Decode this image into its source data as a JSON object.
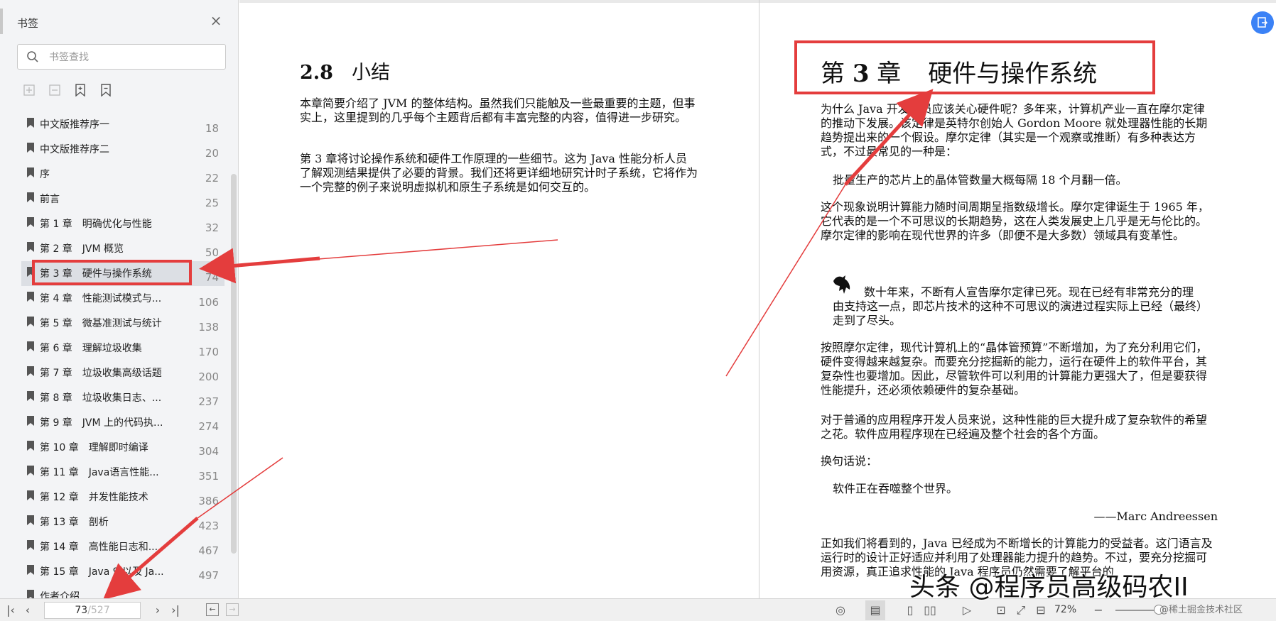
{
  "sidebar": {
    "title": "书签",
    "search_placeholder": "书签查找",
    "items": [
      {
        "label": "中文版推荐序一",
        "page": "18"
      },
      {
        "label": "中文版推荐序二",
        "page": "20"
      },
      {
        "label": "序",
        "page": "22"
      },
      {
        "label": "前言",
        "page": "25"
      },
      {
        "label": "第 1 章　明确优化与性能",
        "page": "32"
      },
      {
        "label": "第 2 章　JVM 概览",
        "page": "50"
      },
      {
        "label": "第 3 章　硬件与操作系统",
        "page": "74"
      },
      {
        "label": "第 4 章　性能测试模式与...",
        "page": "106"
      },
      {
        "label": "第 5 章　微基准测试与统计",
        "page": "138"
      },
      {
        "label": "第 6 章　理解垃圾收集",
        "page": "170"
      },
      {
        "label": "第 7 章　垃圾收集高级话题",
        "page": "200"
      },
      {
        "label": "第 8 章　垃圾收集日志、...",
        "page": "237"
      },
      {
        "label": "第 9 章　JVM 上的代码执...",
        "page": "274"
      },
      {
        "label": "第 10 章　理解即时编译",
        "page": "304"
      },
      {
        "label": "第 11 章　Java语言性能...",
        "page": "351"
      },
      {
        "label": "第 12 章　并发性能技术",
        "page": "386"
      },
      {
        "label": "第 13 章　剖析",
        "page": "423"
      },
      {
        "label": "第 14 章　高性能日志和...",
        "page": "467"
      },
      {
        "label": "第 15 章　Java 9 以及 Ja...",
        "page": "497"
      },
      {
        "label": "作者介绍",
        "page": ""
      }
    ]
  },
  "left_page": {
    "section_num": "2.8",
    "section_title": "小结",
    "p1": "本章简要介绍了 JVM 的整体结构。虽然我们只能触及一些最重要的主题，但事实上，这里提到的几乎每个主题背后都有丰富完整的内容，值得进一步研究。",
    "p2": "第 3 章将讨论操作系统和硬件工作原理的一些细节。这为 Java 性能分析人员了解观测结果提供了必要的背景。我们还将更详细地研究计时子系统，它将作为一个完整的例子来说明虚拟机和原生子系统是如何交互的。"
  },
  "right_page": {
    "chapter_pre": "第",
    "chapter_num": "3",
    "chapter_post": "章",
    "chapter_title": "硬件与操作系统",
    "p1": "为什么 Java 开发人员应该关心硬件呢？多年来，计算机产业一直在摩尔定律的推动下发展。该定律是英特尔创始人 Gordon Moore 就处理器性能的长期趋势提出来的一个假设。摩尔定律（其实是一个观察或推断）有多种表达方式，不过最常见的一种是：",
    "quote1": "批量生产的芯片上的晶体管数量大概每隔 18 个月翻一倍。",
    "p2": "这个现象说明计算能力随时间周期呈指数级增长。摩尔定律诞生于 1965 年，它代表的是一个不可思议的长期趋势，这在人类发展史上几乎是无与伦比的。摩尔定律的影响在现代世界的许多（即便不是大多数）领域具有变革性。",
    "note": "数十年来，不断有人宣告摩尔定律已死。现在已经有非常充分的理由支持这一点，即芯片技术的这种不可思议的演进过程实际上已经（最终）走到了尽头。",
    "p3": "按照摩尔定律，现代计算机上的“晶体管预算”不断增加，为了充分利用它们，硬件变得越来越复杂。而要充分挖掘新的能力，运行在硬件上的软件平台，其复杂性也要增加。因此，尽管软件可以利用的计算能力更强大了，但是要获得性能提升，还必须依赖硬件的复杂基础。",
    "p4": "对于普通的应用程序开发人员来说，这种性能的巨大提升成了复杂软件的希望之花。软件应用程序现在已经遍及整个社会的各个方面。",
    "p5": "换句话说：",
    "quote2": "软件正在吞噬整个世界。",
    "attribution": "——Marc Andreessen",
    "p6": "正如我们将看到的，Java 已经成为不断增长的计算能力的受益者。这门语言及运行时的设计正好适应并利用了处理器能力提升的趋势。不过，要充分挖掘可用资源，真正追求性能的 Java 程序员仍然需要了解平台的"
  },
  "bottom": {
    "current_page": "73",
    "total_pages": "/527",
    "zoom": "72%"
  },
  "watermark": "头条 @程序员高级码农II",
  "watermark_small": "@稀土掘金技术社区",
  "colors": {
    "annotation_red": "#e43d3d",
    "accent_blue": "#3b82f6"
  }
}
